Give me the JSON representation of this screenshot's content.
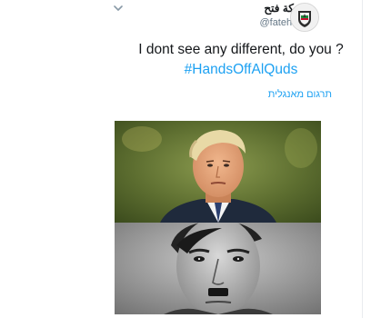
{
  "account": {
    "display_name": "حركة فتح",
    "handle": "@fatehorg",
    "avatar_icon": "fatah-emblem-icon",
    "menu_icon": "chevron-down-icon"
  },
  "tweet": {
    "text": "I dont see any different, do you ?",
    "hashtag": "#HandsOffAlQuds",
    "translate_link": "תרגום מאנגלית"
  },
  "media": {
    "description": "two stacked portraits"
  },
  "colors": {
    "link": "#1da1f2",
    "text": "#14171a",
    "muted": "#657786"
  }
}
